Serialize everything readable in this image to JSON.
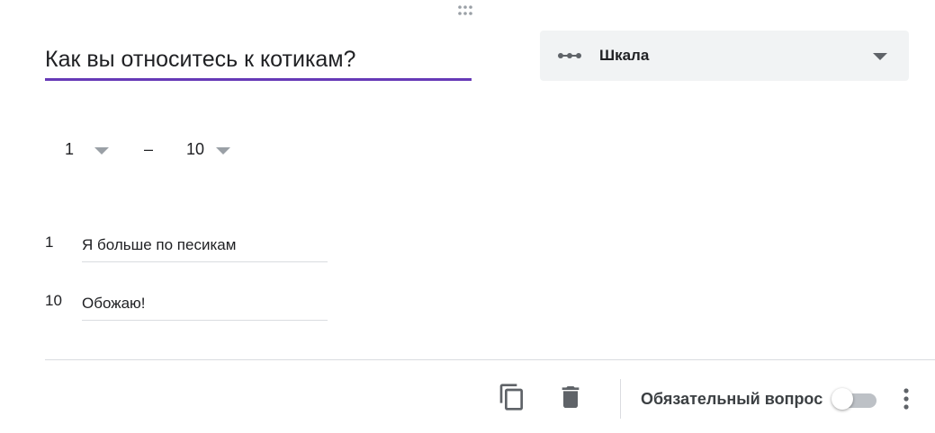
{
  "question": {
    "title": "Как вы относитесь к котикам?"
  },
  "type_select": {
    "icon": "linear-scale-icon",
    "label": "Шкала"
  },
  "scale": {
    "min": "1",
    "dash": "–",
    "max": "10"
  },
  "labels": [
    {
      "number": "1",
      "text": "Я больше по песикам"
    },
    {
      "number": "10",
      "text": "Обожаю!"
    }
  ],
  "footer": {
    "copy_icon": "copy-icon",
    "delete_icon": "trash-icon",
    "required_label": "Обязательный вопрос",
    "required_on": false,
    "more_icon": "more-vertical-icon"
  },
  "colors": {
    "accent": "#673ab7",
    "select_bg": "#f1f3f4",
    "icon_gray": "#5f6368"
  }
}
